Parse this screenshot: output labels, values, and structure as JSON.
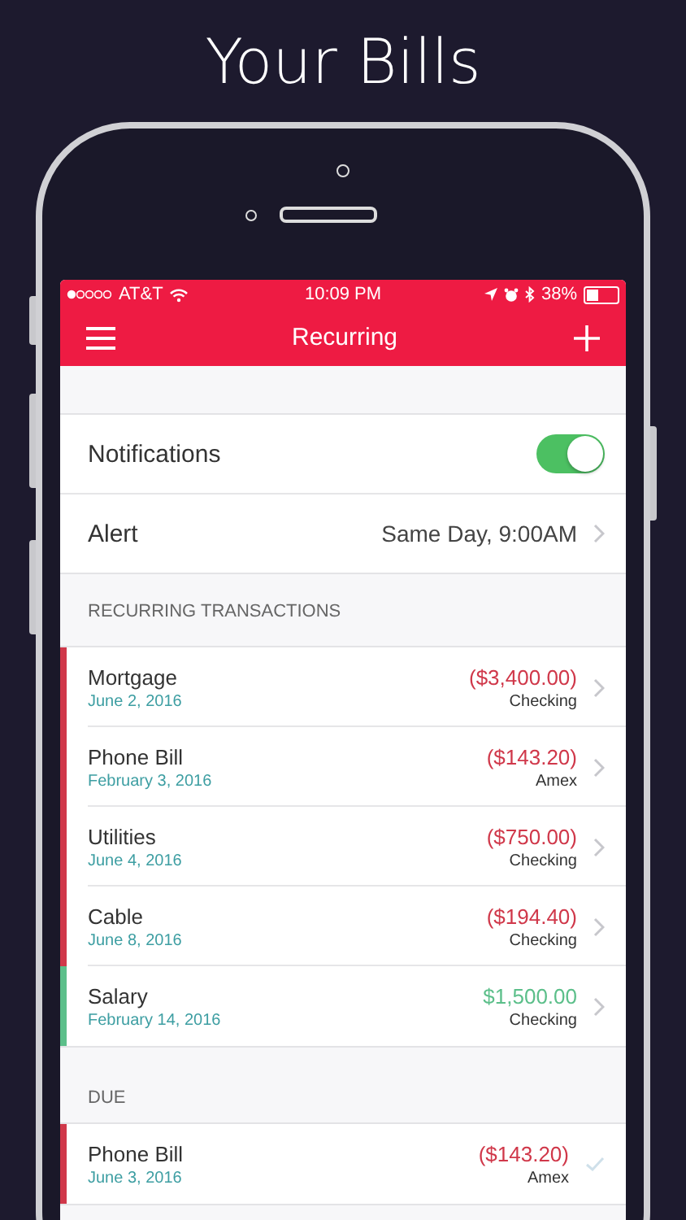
{
  "headline": "Your Bills",
  "status_bar": {
    "carrier": "AT&T",
    "time": "10:09 PM",
    "battery": "38%",
    "level": 0.38
  },
  "nav": {
    "title": "Recurring"
  },
  "settings": [
    {
      "kind": "toggle",
      "label": "Notifications",
      "on": true
    },
    {
      "kind": "value",
      "label": "Alert",
      "value": "Same Day, 9:00AM"
    }
  ],
  "sections": [
    {
      "title": "RECURRING TRANSACTIONS",
      "kind": "chevron",
      "items": [
        {
          "name": "Mortgage",
          "date": "June 2, 2016",
          "amount": "($3,400.00)",
          "account": "Checking",
          "color": "#d0384a"
        },
        {
          "name": "Phone Bill",
          "date": "February 3, 2016",
          "amount": "($143.20)",
          "account": "Amex",
          "color": "#d0384a"
        },
        {
          "name": "Utilities",
          "date": "June 4, 2016",
          "amount": "($750.00)",
          "account": "Checking",
          "color": "#d0384a"
        },
        {
          "name": "Cable",
          "date": "June 8, 2016",
          "amount": "($194.40)",
          "account": "Checking",
          "color": "#d0384a"
        },
        {
          "name": "Salary",
          "date": "February 14, 2016",
          "amount": "$1,500.00",
          "account": "Checking",
          "color": "#5cbf8a"
        }
      ]
    },
    {
      "title": "DUE",
      "kind": "check",
      "items": [
        {
          "name": "Phone Bill",
          "date": "June 3, 2016",
          "amount": "($143.20)",
          "account": "Amex",
          "color": "#d0384a"
        }
      ]
    }
  ]
}
